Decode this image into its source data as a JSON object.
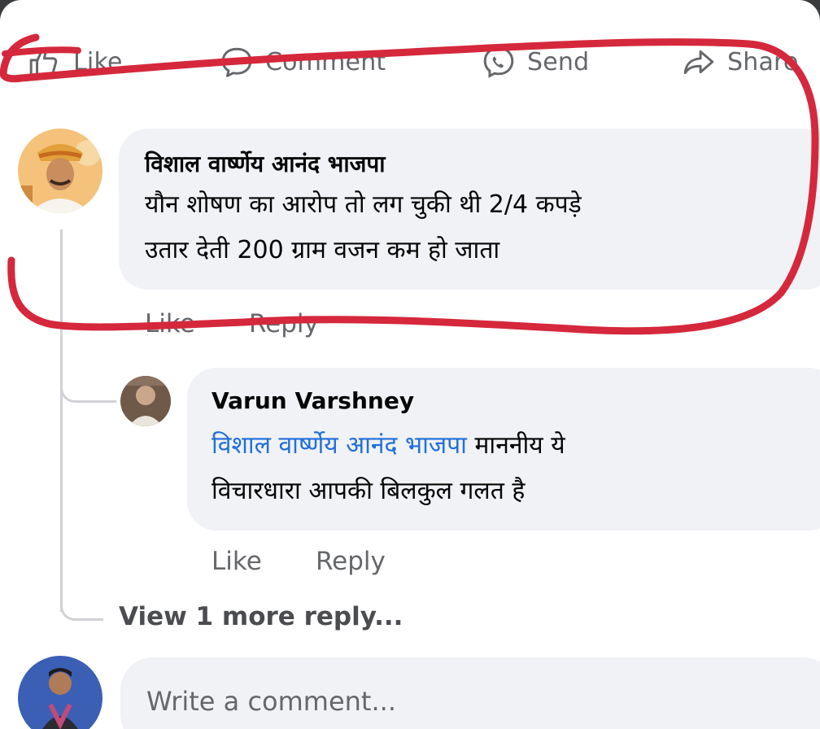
{
  "actions": {
    "like": "Like",
    "comment": "Comment",
    "send": "Send",
    "share": "Share"
  },
  "comment": {
    "author": "विशाल वार्ष्णेय आनंद भाजपा",
    "text_line1": "यौन शोषण का आरोप तो लग चुकी थी 2/4 कपड़े",
    "text_line2": "उतार देती 200 ग्राम वजन कम हो जाता",
    "like": "Like",
    "reply": "Reply"
  },
  "reply": {
    "author": "Varun Varshney",
    "mention": "विशाल वार्ष्णेय आनंद भाजपा",
    "text_after_mention": " माननीय ये",
    "text_line2": "विचारधारा आपकी बिलकुल गलत है",
    "like": "Like",
    "reply": "Reply"
  },
  "view_more": "View 1 more reply...",
  "composer": {
    "placeholder": "Write a comment..."
  },
  "colors": {
    "annotation": "#d5283c",
    "bubble": "#f0f2f5",
    "muted_text": "#65676b",
    "mention": "#216fdb"
  },
  "icons": {
    "like": "thumbs-up-icon",
    "comment": "speech-bubble-icon",
    "send": "messenger-icon",
    "share": "share-arrow-icon"
  }
}
